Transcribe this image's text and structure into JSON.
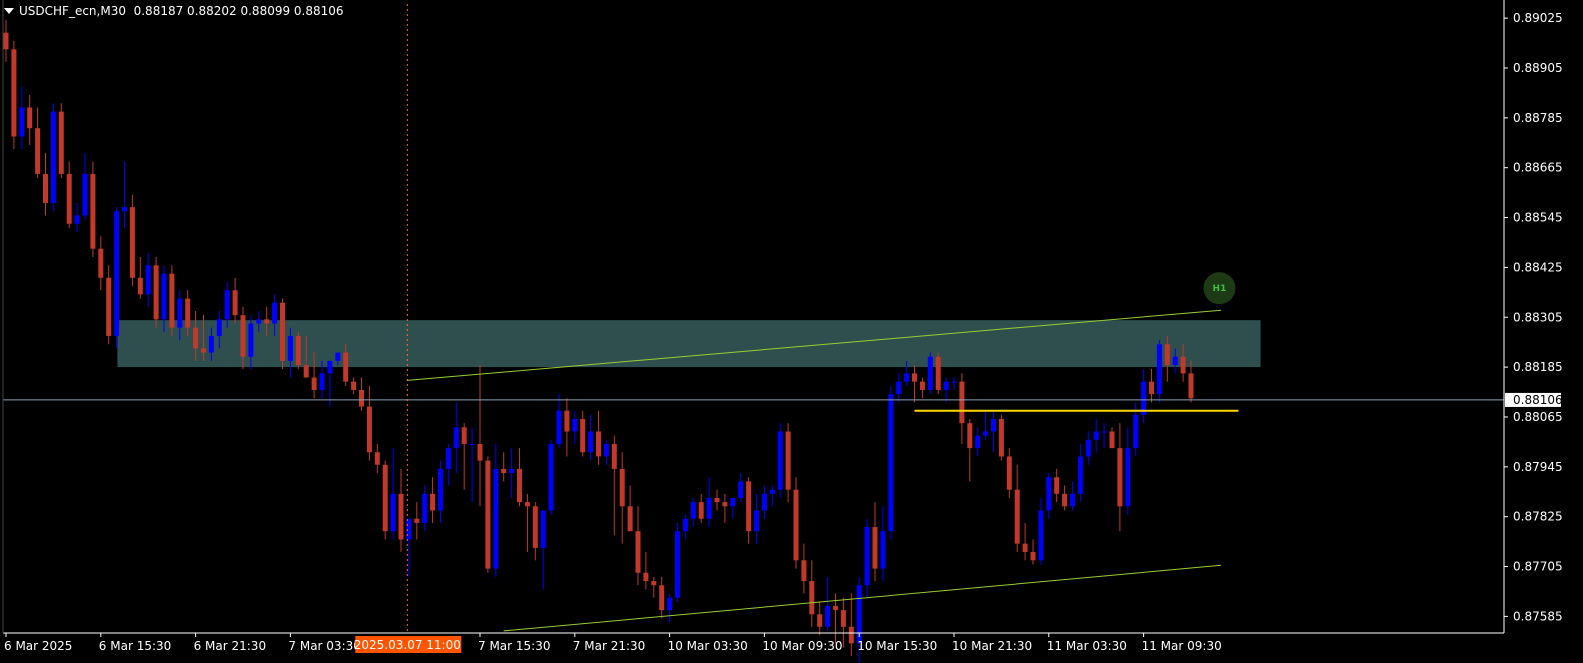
{
  "symbol_info": {
    "symbol": "USDCHF_ecn,M30",
    "ohlc": "0.88187 0.88202 0.88099 0.88106"
  },
  "colors": {
    "background": "#000000",
    "bull": "#0000ff",
    "bear": "#c0392b",
    "zone": "#2f4f4f",
    "trendline": "#9acd32",
    "level": "#ffd700",
    "crosshair": "#ff6633",
    "bid_line": "#8ea3b7",
    "grid_axis": "#ffffff"
  },
  "chart_data": {
    "type": "candlestick",
    "y_ticks": [
      "0.89025",
      "0.88905",
      "0.88785",
      "0.88665",
      "0.88545",
      "0.88425",
      "0.88305",
      "0.88185",
      "0.88065",
      "0.87945",
      "0.87825",
      "0.87705",
      "0.87585"
    ],
    "y_range": [
      0.87545,
      0.89059
    ],
    "x_ticks": [
      {
        "label": "6 Mar 2025",
        "index": 0
      },
      {
        "label": "6 Mar 15:30",
        "index": 12
      },
      {
        "label": "6 Mar 21:30",
        "index": 24
      },
      {
        "label": "7 Mar 03:30",
        "index": 36
      },
      {
        "label": "7 Mar 15:30",
        "index": 60
      },
      {
        "label": "7 Mar 21:30",
        "index": 72
      },
      {
        "label": "10 Mar 03:30",
        "index": 84
      },
      {
        "label": "10 Mar 09:30",
        "index": 96
      },
      {
        "label": "10 Mar 15:30",
        "index": 108
      },
      {
        "label": "10 Mar 21:30",
        "index": 120
      },
      {
        "label": "11 Mar 03:30",
        "index": 132
      },
      {
        "label": "11 Mar 09:30",
        "index": 144
      }
    ],
    "crosshair": {
      "label": "2025.03.07 11:00",
      "index": 50.8
    },
    "current_price": {
      "label": "0.88106",
      "value": 0.88106
    },
    "demand_zone": {
      "x_start": 14.1,
      "x_end": 158.8,
      "top": 0.88298,
      "bottom": 0.88185
    },
    "trendlines": [
      {
        "x1": 50.8,
        "y1": 0.88153,
        "x2": 153.8,
        "y2": 0.88322
      },
      {
        "x1": 63,
        "y1": 0.8755,
        "x2": 153.8,
        "y2": 0.87708
      }
    ],
    "horizontal_level": {
      "x_start": 115,
      "x_end": 156,
      "value": 0.8808
    },
    "badge": {
      "label": "H1",
      "index": 153.6,
      "value": 0.88375
    },
    "candles": [
      {
        "o": 0.8899,
        "h": 0.8902,
        "l": 0.8892,
        "c": 0.8895
      },
      {
        "o": 0.8895,
        "h": 0.8897,
        "l": 0.8871,
        "c": 0.8874
      },
      {
        "o": 0.8874,
        "h": 0.8886,
        "l": 0.8871,
        "c": 0.8881
      },
      {
        "o": 0.8881,
        "h": 0.8884,
        "l": 0.8872,
        "c": 0.8876
      },
      {
        "o": 0.8876,
        "h": 0.8881,
        "l": 0.8864,
        "c": 0.8865
      },
      {
        "o": 0.8865,
        "h": 0.887,
        "l": 0.8855,
        "c": 0.8858
      },
      {
        "o": 0.8858,
        "h": 0.8882,
        "l": 0.8856,
        "c": 0.888
      },
      {
        "o": 0.888,
        "h": 0.8882,
        "l": 0.8864,
        "c": 0.8865
      },
      {
        "o": 0.8865,
        "h": 0.8868,
        "l": 0.8852,
        "c": 0.8853
      },
      {
        "o": 0.8853,
        "h": 0.8858,
        "l": 0.8851,
        "c": 0.8855
      },
      {
        "o": 0.8855,
        "h": 0.887,
        "l": 0.8854,
        "c": 0.8865
      },
      {
        "o": 0.8865,
        "h": 0.8868,
        "l": 0.8845,
        "c": 0.8847
      },
      {
        "o": 0.8847,
        "h": 0.885,
        "l": 0.8837,
        "c": 0.884
      },
      {
        "o": 0.884,
        "h": 0.8843,
        "l": 0.8824,
        "c": 0.8826
      },
      {
        "o": 0.8826,
        "h": 0.8857,
        "l": 0.8823,
        "c": 0.8856
      },
      {
        "o": 0.8856,
        "h": 0.8868,
        "l": 0.8852,
        "c": 0.8857
      },
      {
        "o": 0.8857,
        "h": 0.886,
        "l": 0.8838,
        "c": 0.884
      },
      {
        "o": 0.884,
        "h": 0.8845,
        "l": 0.8835,
        "c": 0.8836
      },
      {
        "o": 0.8836,
        "h": 0.8846,
        "l": 0.8833,
        "c": 0.8843
      },
      {
        "o": 0.8843,
        "h": 0.8845,
        "l": 0.8828,
        "c": 0.883
      },
      {
        "o": 0.883,
        "h": 0.8843,
        "l": 0.8827,
        "c": 0.8841
      },
      {
        "o": 0.8841,
        "h": 0.8843,
        "l": 0.8826,
        "c": 0.8828
      },
      {
        "o": 0.8828,
        "h": 0.8837,
        "l": 0.8825,
        "c": 0.8835
      },
      {
        "o": 0.8835,
        "h": 0.8837,
        "l": 0.8826,
        "c": 0.8828
      },
      {
        "o": 0.8828,
        "h": 0.8832,
        "l": 0.882,
        "c": 0.8823
      },
      {
        "o": 0.8823,
        "h": 0.8831,
        "l": 0.882,
        "c": 0.8822
      },
      {
        "o": 0.8822,
        "h": 0.8828,
        "l": 0.882,
        "c": 0.8826
      },
      {
        "o": 0.8826,
        "h": 0.8832,
        "l": 0.8823,
        "c": 0.883
      },
      {
        "o": 0.883,
        "h": 0.8839,
        "l": 0.8828,
        "c": 0.8837
      },
      {
        "o": 0.8837,
        "h": 0.884,
        "l": 0.8829,
        "c": 0.8831
      },
      {
        "o": 0.8831,
        "h": 0.8833,
        "l": 0.8818,
        "c": 0.8821
      },
      {
        "o": 0.8821,
        "h": 0.8831,
        "l": 0.8818,
        "c": 0.8829
      },
      {
        "o": 0.8829,
        "h": 0.8832,
        "l": 0.8827,
        "c": 0.883
      },
      {
        "o": 0.883,
        "h": 0.8833,
        "l": 0.8826,
        "c": 0.8829
      },
      {
        "o": 0.8829,
        "h": 0.8836,
        "l": 0.8826,
        "c": 0.8834
      },
      {
        "o": 0.8834,
        "h": 0.8835,
        "l": 0.8818,
        "c": 0.882
      },
      {
        "o": 0.882,
        "h": 0.8828,
        "l": 0.8816,
        "c": 0.8826
      },
      {
        "o": 0.8826,
        "h": 0.8827,
        "l": 0.8818,
        "c": 0.8819
      },
      {
        "o": 0.8819,
        "h": 0.8826,
        "l": 0.8816,
        "c": 0.8816
      },
      {
        "o": 0.8816,
        "h": 0.8822,
        "l": 0.8811,
        "c": 0.8813
      },
      {
        "o": 0.8813,
        "h": 0.882,
        "l": 0.8811,
        "c": 0.8817
      },
      {
        "o": 0.8817,
        "h": 0.882,
        "l": 0.8809,
        "c": 0.882
      },
      {
        "o": 0.882,
        "h": 0.8822,
        "l": 0.8819,
        "c": 0.8822
      },
      {
        "o": 0.8822,
        "h": 0.8824,
        "l": 0.8814,
        "c": 0.8815
      },
      {
        "o": 0.8815,
        "h": 0.8816,
        "l": 0.8812,
        "c": 0.8813
      },
      {
        "o": 0.8813,
        "h": 0.8816,
        "l": 0.8808,
        "c": 0.8809
      },
      {
        "o": 0.8809,
        "h": 0.8814,
        "l": 0.8796,
        "c": 0.8798
      },
      {
        "o": 0.8798,
        "h": 0.88,
        "l": 0.8793,
        "c": 0.8795
      },
      {
        "o": 0.8795,
        "h": 0.8796,
        "l": 0.8777,
        "c": 0.8779
      },
      {
        "o": 0.8779,
        "h": 0.8799,
        "l": 0.8777,
        "c": 0.8788
      },
      {
        "o": 0.8788,
        "h": 0.8794,
        "l": 0.8774,
        "c": 0.8777
      },
      {
        "o": 0.8777,
        "h": 0.878,
        "l": 0.8768,
        "c": 0.8782
      },
      {
        "o": 0.8782,
        "h": 0.8786,
        "l": 0.8777,
        "c": 0.8781
      },
      {
        "o": 0.8781,
        "h": 0.879,
        "l": 0.8779,
        "c": 0.8788
      },
      {
        "o": 0.8788,
        "h": 0.8792,
        "l": 0.8781,
        "c": 0.8784
      },
      {
        "o": 0.8784,
        "h": 0.8796,
        "l": 0.8781,
        "c": 0.8794
      },
      {
        "o": 0.8794,
        "h": 0.88,
        "l": 0.879,
        "c": 0.8799
      },
      {
        "o": 0.8799,
        "h": 0.881,
        "l": 0.8793,
        "c": 0.8804
      },
      {
        "o": 0.8804,
        "h": 0.8805,
        "l": 0.8789,
        "c": 0.88
      },
      {
        "o": 0.88,
        "h": 0.8804,
        "l": 0.8786,
        "c": 0.88
      },
      {
        "o": 0.88,
        "h": 0.8819,
        "l": 0.8785,
        "c": 0.8796
      },
      {
        "o": 0.8796,
        "h": 0.8797,
        "l": 0.8769,
        "c": 0.877
      },
      {
        "o": 0.877,
        "h": 0.88,
        "l": 0.8768,
        "c": 0.8794
      },
      {
        "o": 0.8794,
        "h": 0.8798,
        "l": 0.8791,
        "c": 0.8793
      },
      {
        "o": 0.8793,
        "h": 0.8799,
        "l": 0.8787,
        "c": 0.8794
      },
      {
        "o": 0.8794,
        "h": 0.8799,
        "l": 0.8785,
        "c": 0.8786
      },
      {
        "o": 0.8786,
        "h": 0.8788,
        "l": 0.8774,
        "c": 0.8785
      },
      {
        "o": 0.8785,
        "h": 0.8786,
        "l": 0.8772,
        "c": 0.8775
      },
      {
        "o": 0.8775,
        "h": 0.8784,
        "l": 0.8765,
        "c": 0.8784
      },
      {
        "o": 0.8784,
        "h": 0.8801,
        "l": 0.8783,
        "c": 0.88
      },
      {
        "o": 0.88,
        "h": 0.8812,
        "l": 0.8799,
        "c": 0.8808
      },
      {
        "o": 0.8808,
        "h": 0.8811,
        "l": 0.8797,
        "c": 0.8803
      },
      {
        "o": 0.8803,
        "h": 0.8808,
        "l": 0.88,
        "c": 0.8806
      },
      {
        "o": 0.8806,
        "h": 0.8808,
        "l": 0.8797,
        "c": 0.8798
      },
      {
        "o": 0.8798,
        "h": 0.8807,
        "l": 0.8796,
        "c": 0.8803
      },
      {
        "o": 0.8803,
        "h": 0.8808,
        "l": 0.8795,
        "c": 0.8797
      },
      {
        "o": 0.8797,
        "h": 0.8801,
        "l": 0.8795,
        "c": 0.88
      },
      {
        "o": 0.88,
        "h": 0.8802,
        "l": 0.8778,
        "c": 0.8794
      },
      {
        "o": 0.8794,
        "h": 0.8798,
        "l": 0.8776,
        "c": 0.8785
      },
      {
        "o": 0.8785,
        "h": 0.879,
        "l": 0.8779,
        "c": 0.8779
      },
      {
        "o": 0.8779,
        "h": 0.8785,
        "l": 0.8766,
        "c": 0.8769
      },
      {
        "o": 0.8769,
        "h": 0.8774,
        "l": 0.8765,
        "c": 0.8767
      },
      {
        "o": 0.8767,
        "h": 0.8768,
        "l": 0.8763,
        "c": 0.8766
      },
      {
        "o": 0.8766,
        "h": 0.8768,
        "l": 0.8758,
        "c": 0.876
      },
      {
        "o": 0.876,
        "h": 0.8764,
        "l": 0.8757,
        "c": 0.8763
      },
      {
        "o": 0.8763,
        "h": 0.8781,
        "l": 0.8762,
        "c": 0.8779
      },
      {
        "o": 0.8779,
        "h": 0.8783,
        "l": 0.8777,
        "c": 0.8782
      },
      {
        "o": 0.8782,
        "h": 0.8787,
        "l": 0.878,
        "c": 0.8786
      },
      {
        "o": 0.8786,
        "h": 0.8788,
        "l": 0.8781,
        "c": 0.8782
      },
      {
        "o": 0.8782,
        "h": 0.8792,
        "l": 0.878,
        "c": 0.8787
      },
      {
        "o": 0.8787,
        "h": 0.8789,
        "l": 0.8784,
        "c": 0.8786
      },
      {
        "o": 0.8786,
        "h": 0.8788,
        "l": 0.8781,
        "c": 0.8785
      },
      {
        "o": 0.8785,
        "h": 0.8787,
        "l": 0.8782,
        "c": 0.8787
      },
      {
        "o": 0.8787,
        "h": 0.8793,
        "l": 0.8786,
        "c": 0.8791
      },
      {
        "o": 0.8791,
        "h": 0.8792,
        "l": 0.8776,
        "c": 0.8779
      },
      {
        "o": 0.8779,
        "h": 0.8788,
        "l": 0.8776,
        "c": 0.8784
      },
      {
        "o": 0.8784,
        "h": 0.879,
        "l": 0.8782,
        "c": 0.8788
      },
      {
        "o": 0.8788,
        "h": 0.879,
        "l": 0.8785,
        "c": 0.8789
      },
      {
        "o": 0.8789,
        "h": 0.8805,
        "l": 0.8787,
        "c": 0.8803
      },
      {
        "o": 0.8803,
        "h": 0.8805,
        "l": 0.8786,
        "c": 0.8789
      },
      {
        "o": 0.8789,
        "h": 0.8792,
        "l": 0.877,
        "c": 0.8772
      },
      {
        "o": 0.8772,
        "h": 0.8776,
        "l": 0.8764,
        "c": 0.8767
      },
      {
        "o": 0.8767,
        "h": 0.8772,
        "l": 0.8756,
        "c": 0.8759
      },
      {
        "o": 0.8759,
        "h": 0.8762,
        "l": 0.8754,
        "c": 0.8756
      },
      {
        "o": 0.8756,
        "h": 0.8768,
        "l": 0.8755,
        "c": 0.8761
      },
      {
        "o": 0.8761,
        "h": 0.8764,
        "l": 0.8752,
        "c": 0.876
      },
      {
        "o": 0.876,
        "h": 0.8763,
        "l": 0.8751,
        "c": 0.8756
      },
      {
        "o": 0.8756,
        "h": 0.8764,
        "l": 0.8749,
        "c": 0.8752
      },
      {
        "o": 0.8752,
        "h": 0.8768,
        "l": 0.8747,
        "c": 0.8766
      },
      {
        "o": 0.8766,
        "h": 0.8782,
        "l": 0.8763,
        "c": 0.878
      },
      {
        "o": 0.878,
        "h": 0.8786,
        "l": 0.8767,
        "c": 0.877
      },
      {
        "o": 0.877,
        "h": 0.8785,
        "l": 0.8767,
        "c": 0.8779
      },
      {
        "o": 0.8779,
        "h": 0.8814,
        "l": 0.8777,
        "c": 0.8812
      },
      {
        "o": 0.8812,
        "h": 0.8817,
        "l": 0.881,
        "c": 0.8815
      },
      {
        "o": 0.8815,
        "h": 0.882,
        "l": 0.8814,
        "c": 0.8817
      },
      {
        "o": 0.8817,
        "h": 0.8819,
        "l": 0.881,
        "c": 0.8815
      },
      {
        "o": 0.8815,
        "h": 0.8816,
        "l": 0.8811,
        "c": 0.8813
      },
      {
        "o": 0.8813,
        "h": 0.8822,
        "l": 0.8812,
        "c": 0.8821
      },
      {
        "o": 0.8821,
        "h": 0.8822,
        "l": 0.8812,
        "c": 0.8813
      },
      {
        "o": 0.8813,
        "h": 0.8816,
        "l": 0.881,
        "c": 0.8815
      },
      {
        "o": 0.8815,
        "h": 0.8816,
        "l": 0.8813,
        "c": 0.8815
      },
      {
        "o": 0.8815,
        "h": 0.8817,
        "l": 0.88,
        "c": 0.8805
      },
      {
        "o": 0.8805,
        "h": 0.8806,
        "l": 0.8791,
        "c": 0.8799
      },
      {
        "o": 0.8799,
        "h": 0.8804,
        "l": 0.8797,
        "c": 0.8802
      },
      {
        "o": 0.8802,
        "h": 0.8808,
        "l": 0.8801,
        "c": 0.8803
      },
      {
        "o": 0.8803,
        "h": 0.8808,
        "l": 0.8798,
        "c": 0.8806
      },
      {
        "o": 0.8806,
        "h": 0.8807,
        "l": 0.8796,
        "c": 0.8797
      },
      {
        "o": 0.8797,
        "h": 0.8799,
        "l": 0.8787,
        "c": 0.8789
      },
      {
        "o": 0.8789,
        "h": 0.8795,
        "l": 0.8774,
        "c": 0.8776
      },
      {
        "o": 0.8776,
        "h": 0.8781,
        "l": 0.8772,
        "c": 0.8774
      },
      {
        "o": 0.8774,
        "h": 0.8777,
        "l": 0.8771,
        "c": 0.8772
      },
      {
        "o": 0.8772,
        "h": 0.8787,
        "l": 0.8771,
        "c": 0.8784
      },
      {
        "o": 0.8784,
        "h": 0.8793,
        "l": 0.8782,
        "c": 0.8792
      },
      {
        "o": 0.8792,
        "h": 0.8794,
        "l": 0.8786,
        "c": 0.8788
      },
      {
        "o": 0.8788,
        "h": 0.879,
        "l": 0.8784,
        "c": 0.8785
      },
      {
        "o": 0.8785,
        "h": 0.8791,
        "l": 0.8784,
        "c": 0.8788
      },
      {
        "o": 0.8788,
        "h": 0.88,
        "l": 0.8786,
        "c": 0.8797
      },
      {
        "o": 0.8797,
        "h": 0.8803,
        "l": 0.8795,
        "c": 0.8801
      },
      {
        "o": 0.8801,
        "h": 0.8806,
        "l": 0.8798,
        "c": 0.8803
      },
      {
        "o": 0.8803,
        "h": 0.8805,
        "l": 0.8799,
        "c": 0.8803
      },
      {
        "o": 0.8803,
        "h": 0.8804,
        "l": 0.8799,
        "c": 0.8799
      },
      {
        "o": 0.8799,
        "h": 0.8805,
        "l": 0.8779,
        "c": 0.8785
      },
      {
        "o": 0.8785,
        "h": 0.8804,
        "l": 0.8783,
        "c": 0.8799
      },
      {
        "o": 0.8799,
        "h": 0.881,
        "l": 0.8797,
        "c": 0.8807
      },
      {
        "o": 0.8807,
        "h": 0.8818,
        "l": 0.8805,
        "c": 0.8815
      },
      {
        "o": 0.8815,
        "h": 0.8818,
        "l": 0.881,
        "c": 0.8812
      },
      {
        "o": 0.8812,
        "h": 0.8825,
        "l": 0.881,
        "c": 0.8824
      },
      {
        "o": 0.8824,
        "h": 0.8826,
        "l": 0.8815,
        "c": 0.8819
      },
      {
        "o": 0.8819,
        "h": 0.8823,
        "l": 0.8817,
        "c": 0.8821
      },
      {
        "o": 0.8821,
        "h": 0.8824,
        "l": 0.8815,
        "c": 0.8817
      },
      {
        "o": 0.8817,
        "h": 0.882,
        "l": 0.881,
        "c": 0.8811
      }
    ]
  }
}
